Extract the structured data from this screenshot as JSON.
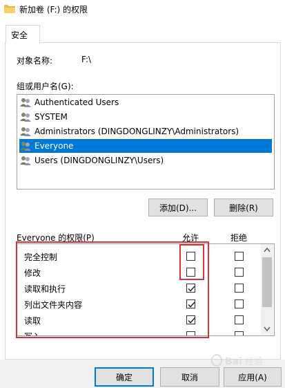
{
  "window": {
    "title": "新加卷 (F:) 的权限",
    "title_icon": "folder-icon"
  },
  "tabs": [
    {
      "label": "安全",
      "active": true
    }
  ],
  "object": {
    "label": "对象名称:",
    "value": "F:\\"
  },
  "groups": {
    "label": "组或用户名(G):",
    "users": [
      {
        "name": "Authenticated Users",
        "icon": "users-icon",
        "selected": false
      },
      {
        "name": "SYSTEM",
        "icon": "users-icon",
        "selected": false
      },
      {
        "name": "Administrators (DINGDONGLINZY\\Administrators)",
        "icon": "users-icon",
        "selected": false
      },
      {
        "name": "Everyone",
        "icon": "users-icon",
        "selected": true
      },
      {
        "name": "Users (DINGDONGLINZY\\Users)",
        "icon": "users-icon",
        "selected": false
      }
    ],
    "add_label": "添加(D)...",
    "remove_label": "删除(R)"
  },
  "permissions": {
    "label": "Everyone 的权限(P)",
    "allow_header": "允许",
    "deny_header": "拒绝",
    "rows": [
      {
        "name": "完全控制",
        "allow": false,
        "deny": false
      },
      {
        "name": "修改",
        "allow": false,
        "deny": false
      },
      {
        "name": "读取和执行",
        "allow": true,
        "deny": false
      },
      {
        "name": "列出文件夹内容",
        "allow": true,
        "deny": false
      },
      {
        "name": "读取",
        "allow": true,
        "deny": false
      },
      {
        "name": "写入",
        "allow": false,
        "deny": false
      }
    ]
  },
  "buttons": {
    "ok": "确定",
    "cancel": "取消",
    "apply": "应用(A)"
  },
  "colors": {
    "selection": "#0078d7",
    "annotation": "#d9313a"
  },
  "watermark": "Baidu 经验"
}
